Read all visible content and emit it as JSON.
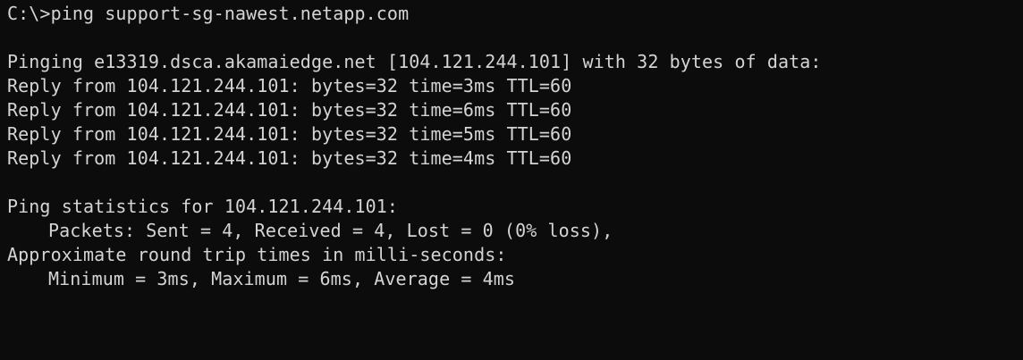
{
  "terminal": {
    "lines": [
      "C:\\>ping support-sg-nawest.netapp.com",
      "",
      "Pinging e13319.dsca.akamaiedge.net [104.121.244.101] with 32 bytes of data:",
      "Reply from 104.121.244.101: bytes=32 time=3ms TTL=60",
      "Reply from 104.121.244.101: bytes=32 time=6ms TTL=60",
      "Reply from 104.121.244.101: bytes=32 time=5ms TTL=60",
      "Reply from 104.121.244.101: bytes=32 time=4ms TTL=60",
      "",
      "Ping statistics for 104.121.244.101:",
      "Packets: Sent = 4, Received = 4, Lost = 0 (0% loss),",
      "Approximate round trip times in milli-seconds:",
      "Minimum = 3ms, Maximum = 6ms, Average = 4ms"
    ]
  },
  "colors": {
    "background": "#0c0c0c",
    "text": "#d4d4d4"
  }
}
